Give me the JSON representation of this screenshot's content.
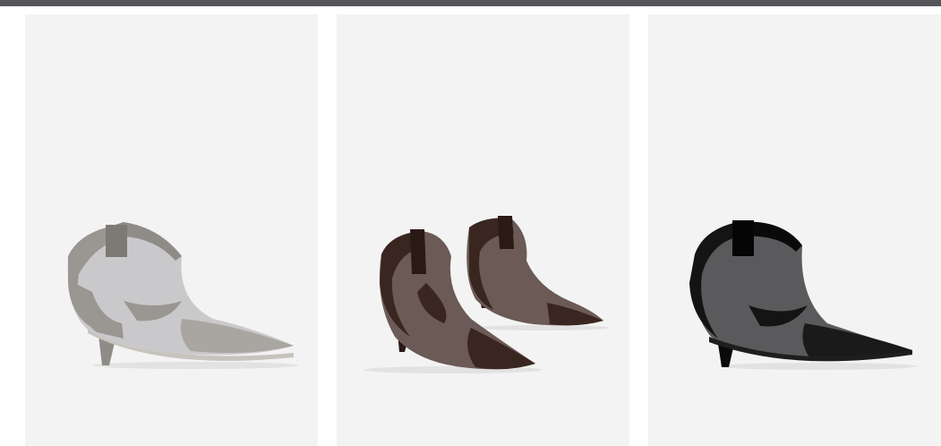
{
  "products": [
    {
      "id": "product-grey-mesh-boot",
      "icon": "boot-icon",
      "colors": {
        "suede": "#9a9792",
        "suede_dark": "#7d7a76",
        "mesh": "#c9c9cb",
        "sole": "#c7c3bd"
      }
    },
    {
      "id": "product-brown-mesh-boots",
      "icon": "boot-pair-icon",
      "colors": {
        "suede": "#3a2620",
        "suede_dark": "#2a1a15",
        "mesh": "#6b5a55",
        "sole": "#4a322a"
      }
    },
    {
      "id": "product-black-mesh-boot",
      "icon": "boot-icon",
      "colors": {
        "suede": "#141414",
        "suede_dark": "#050505",
        "mesh": "#5a5a5c",
        "sole": "#1e1e1e"
      }
    }
  ],
  "colors": {
    "top_bar": "#56565a",
    "card_background": "#f3f3f3"
  }
}
